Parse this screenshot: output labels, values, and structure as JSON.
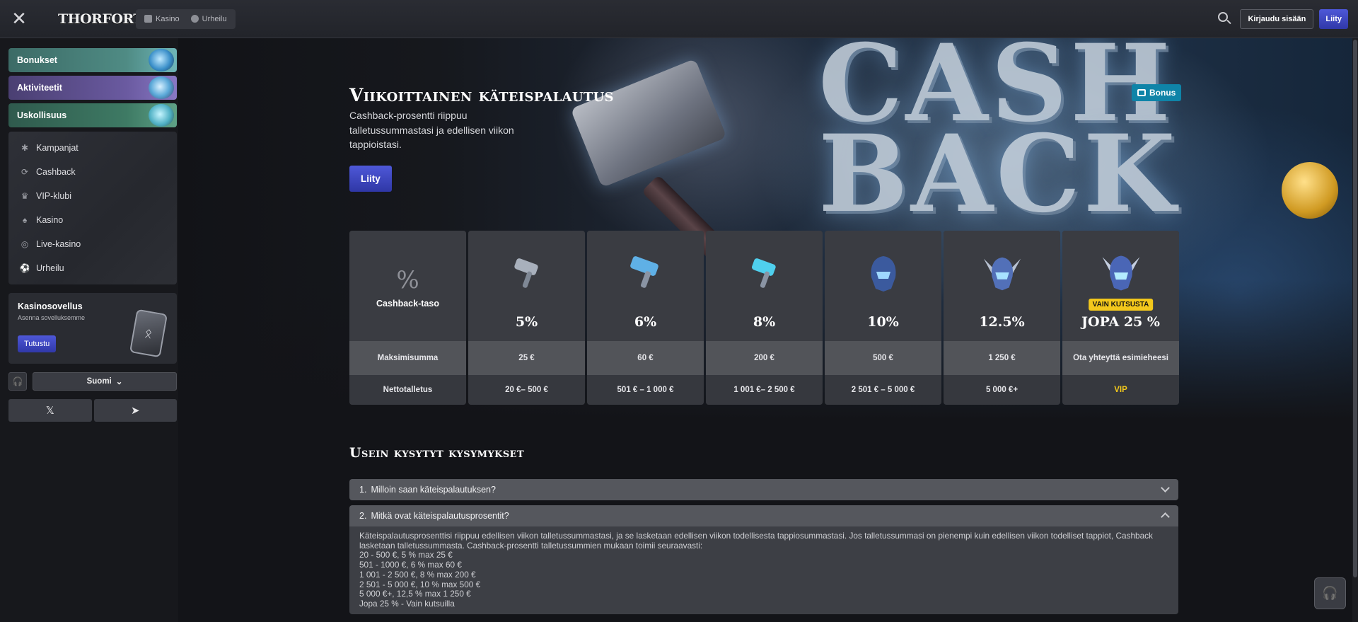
{
  "topbar": {
    "logo_text": "THORFORTUNE",
    "tabs": [
      {
        "label": "Kasino",
        "icon": "casino-icon"
      },
      {
        "label": "Urheilu",
        "icon": "sports-ball-icon"
      }
    ],
    "login_label": "Kirjaudu sisään",
    "join_label": "Liity"
  },
  "sidebar": {
    "promo_tiles": [
      {
        "label": "Bonukset"
      },
      {
        "label": "Aktiviteetit"
      },
      {
        "label": "Uskollisuus"
      }
    ],
    "nav_items": [
      {
        "label": "Kampanjat",
        "icon": "promotions-icon"
      },
      {
        "label": "Cashback",
        "icon": "cashback-icon"
      },
      {
        "label": "VIP-klubi",
        "icon": "crown-icon"
      },
      {
        "label": "Kasino",
        "icon": "cards-icon"
      },
      {
        "label": "Live-kasino",
        "icon": "live-casino-icon"
      },
      {
        "label": "Urheilu",
        "icon": "sports-icon"
      }
    ],
    "app": {
      "title": "Kasinosovellus",
      "subtitle": "Asenna sovelluksemme",
      "button": "Tutustu"
    },
    "language": "Suomi"
  },
  "hero": {
    "title": "Viikoittainen käteispalautus",
    "description": "Cashback-prosentti riippuu talletussummastasi ja edellisen viikon tappioistasi.",
    "join_label": "Liity",
    "badge": "Bonus",
    "art_text": "CASH BACK"
  },
  "tiers": {
    "header_label": "Cashback-taso",
    "header_symbol": "%",
    "max_label": "Maksimisumma",
    "deposit_label": "Nettotalletus",
    "levels": [
      {
        "percent": "5%",
        "max": "25 €",
        "deposit": "20 €– 500 €",
        "icon": "silver-hammer-icon"
      },
      {
        "percent": "6%",
        "max": "60 €",
        "deposit": "501 € – 1 000 €",
        "icon": "blue-hammer-icon"
      },
      {
        "percent": "8%",
        "max": "200 €",
        "deposit": "1 001 €– 2 500 €",
        "icon": "crystal-hammer-icon"
      },
      {
        "percent": "10%",
        "max": "500 €",
        "deposit": "2 501 € – 5 000 €",
        "icon": "helmet-icon"
      },
      {
        "percent": "12.5%",
        "max": "1 250 €",
        "deposit": "5 000 €+",
        "icon": "winged-helmet-icon"
      }
    ],
    "vip": {
      "chip": "VAIN KUTSUSTA",
      "percent": "JOPA 25 %",
      "max": "Ota yhteyttä esimieheesi",
      "deposit": "VIP",
      "icon": "vip-helmet-icon"
    }
  },
  "faq": {
    "title": "Usein kysytyt kysymykset",
    "items": [
      {
        "num": "1.",
        "question": "Milloin saan käteispalautuksen?",
        "open": false
      },
      {
        "num": "2.",
        "question": "Mitkä ovat käteispalautusprosentit?",
        "open": true
      }
    ],
    "answer_intro": "Käteispalautusprosenttisi riippuu edellisen viikon talletussummastasi, ja se lasketaan edellisen viikon todellisesta tappiosummastasi. Jos talletussummasi on pienempi kuin edellisen viikon todelliset tappiot, Cashback lasketaan talletussummasta. Cashback-prosentti talletussummien mukaan toimii seuraavasti:",
    "answer_lines": [
      "20 - 500 €, 5 % max 25 €",
      "501 - 1000 €, 6 % max 60 €",
      "1 001 - 2 500 €, 8 % max 200 €",
      "2 501 - 5 000 €, 10 % max 500 €",
      "5 000 €+, 12,5 % max 1 250 €",
      "Jopa 25 % - Vain kutsuilla"
    ]
  },
  "colors": {
    "accent": "#3f49c8",
    "vip_gold": "#f3c81c",
    "bonus_badge": "#0f84a8"
  }
}
